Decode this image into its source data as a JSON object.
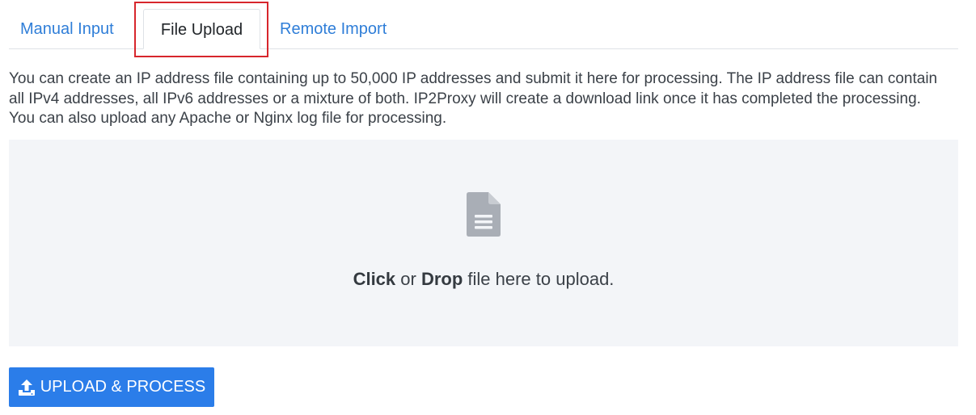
{
  "tabs": [
    {
      "label": "Manual Input",
      "active": false
    },
    {
      "label": "File Upload",
      "active": true
    },
    {
      "label": "Remote Import",
      "active": false
    }
  ],
  "description": "You can create an IP address file containing up to 50,000 IP addresses and submit it here for processing. The IP address file can contain all IPv4 addresses, all IPv6 addresses or a mixture of both. IP2Proxy will create a download link once it has completed the processing. You can also upload any Apache or Nginx log file for processing.",
  "dropzone": {
    "icon": "file-text-icon",
    "click_word": "Click",
    "or_word": " or ",
    "drop_word": "Drop",
    "rest_text": " file here to upload."
  },
  "upload_button": {
    "icon": "upload-icon",
    "label": "UPLOAD & PROCESS"
  },
  "colors": {
    "accent": "#2b7de9",
    "tab_link": "#2f7ed8",
    "highlight": "#d7262c",
    "dropzone_bg": "#f3f5f8",
    "icon_gray": "#a9aeb6"
  }
}
